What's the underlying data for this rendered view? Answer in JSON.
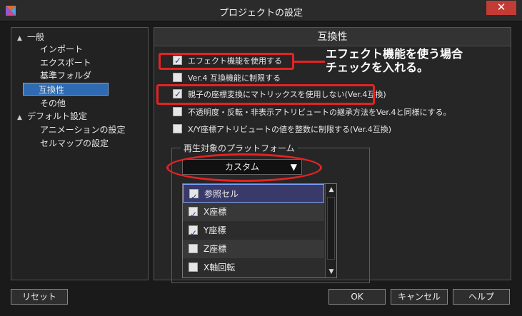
{
  "window": {
    "title": "プロジェクトの設定",
    "close_glyph": "✕"
  },
  "tree": {
    "items": [
      {
        "label": "一般",
        "arrow": "▲"
      },
      {
        "label": "インポート"
      },
      {
        "label": "エクスポート"
      },
      {
        "label": "基準フォルダ"
      },
      {
        "label": "互換性"
      },
      {
        "label": "その他"
      },
      {
        "label": "デフォルト設定",
        "arrow": "▲"
      },
      {
        "label": "アニメーションの設定"
      },
      {
        "label": "セルマップの設定"
      }
    ]
  },
  "content": {
    "header": "互換性",
    "options": [
      {
        "label": "エフェクト機能を使用する",
        "checked": true
      },
      {
        "label": "Ver.4 互換機能に制限する",
        "checked": false
      },
      {
        "label": "親子の座標変換にマトリックスを使用しない(Ver.4互換)",
        "checked": true
      },
      {
        "label": "不透明度・反転・非表示アトリビュートの継承方法をVer.4と同様にする。",
        "checked": false
      },
      {
        "label": "X/Y座標アトリビュートの値を整数に制限する(Ver.4互換)",
        "checked": false
      }
    ],
    "annotation": {
      "line1": "エフェクト機能を使う場合",
      "line2": "チェックを入れる。"
    },
    "platform": {
      "group_label": "再生対象のプラットフォーム",
      "dropdown_value": "カスタム",
      "dropdown_arrow": "▼",
      "list": [
        {
          "label": "参照セル",
          "checked": true
        },
        {
          "label": "X座標",
          "checked": true
        },
        {
          "label": "Y座標",
          "checked": true
        },
        {
          "label": "Z座標",
          "checked": false
        },
        {
          "label": "X軸回転",
          "checked": false
        }
      ]
    }
  },
  "buttons": {
    "reset": "リセット",
    "ok": "OK",
    "cancel": "キャンセル",
    "help": "ヘルプ"
  },
  "colors": {
    "accent_red": "#e52222",
    "selection_blue": "#2f6bb3"
  }
}
